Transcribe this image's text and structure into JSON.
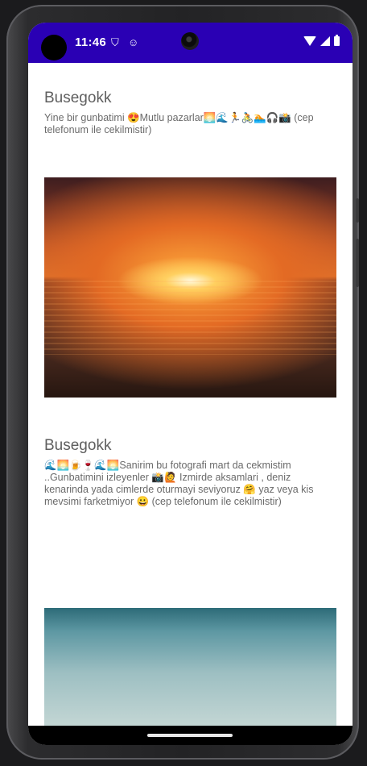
{
  "status_bar": {
    "time": "11:46",
    "icons": [
      "shield-icon",
      "face-icon",
      "wifi-icon",
      "signal-icon",
      "battery-icon"
    ],
    "background_color": "#2a00b4"
  },
  "posts": [
    {
      "title": "Busegokk",
      "caption": "Yine bir gunbatimi 😍Mutlu pazarlar🌅🌊🏃🚴🏊🎧📸 (cep telefonum ile cekilmistir)",
      "image": "sunset-beach-photo"
    },
    {
      "title": "Busegokk",
      "caption": "🌊🌅🍺🍷🌊🌅Sanirim bu fotografi mart da cekmistim ..Gunbatimini izleyenler 📸🙋 Izmirde aksamlari , deniz kenarinda yada cimlerde oturmayi seviyoruz 🤗 yaz veya kis mevsimi farketmiyor 😀 (cep telefonum ile cekilmistir)",
      "image": "sea-horizon-photo"
    }
  ]
}
